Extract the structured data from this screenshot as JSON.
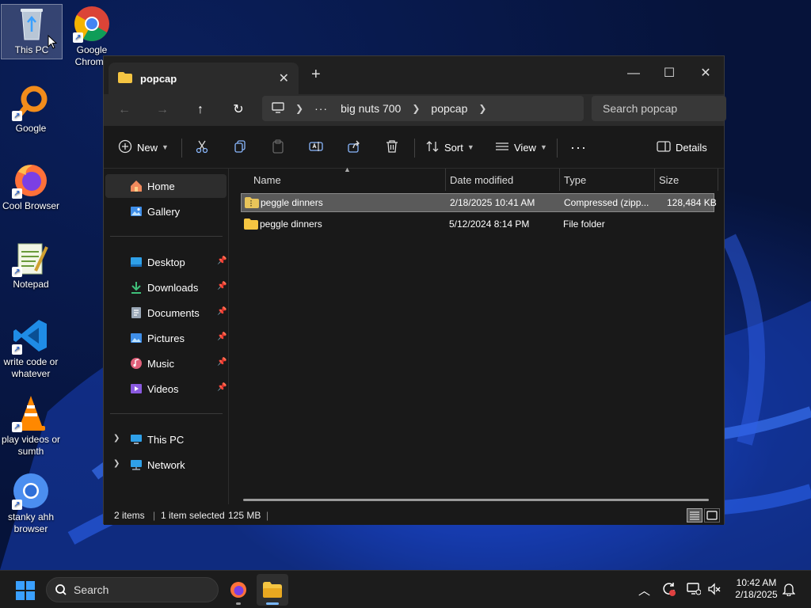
{
  "desktop": {
    "icons": [
      {
        "label": "This PC"
      },
      {
        "label": "Google Chrome"
      },
      {
        "label": "Google"
      },
      {
        "label": "Cool Browser"
      },
      {
        "label": "Notepad"
      },
      {
        "label": "write code or whatever"
      },
      {
        "label": "play videos or sumth"
      },
      {
        "label": "stanky ahh browser"
      }
    ]
  },
  "window": {
    "tab_title": "popcap",
    "controls": {
      "minimize": "—",
      "maximize": "☐",
      "close": "✕"
    },
    "breadcrumb": [
      "big nuts 700",
      "popcap"
    ],
    "search_placeholder": "Search popcap",
    "toolbar": {
      "new_label": "New",
      "sort_label": "Sort",
      "view_label": "View",
      "details_label": "Details"
    },
    "sidebar": {
      "home": "Home",
      "gallery": "Gallery",
      "pinned": [
        "Desktop",
        "Downloads",
        "Documents",
        "Pictures",
        "Music",
        "Videos"
      ],
      "this_pc": "This PC",
      "network": "Network"
    },
    "columns": {
      "name": "Name",
      "date": "Date modified",
      "type": "Type",
      "size": "Size"
    },
    "files": [
      {
        "name": "peggle dinners",
        "date": "2/18/2025 10:41 AM",
        "type": "Compressed (zipp...",
        "size": "128,484 KB",
        "kind": "zip"
      },
      {
        "name": "peggle dinners",
        "date": "5/12/2024 8:14 PM",
        "type": "File folder",
        "size": "",
        "kind": "folder"
      }
    ],
    "status": {
      "count": "2 items",
      "selected": "1 item selected",
      "size": "125 MB"
    }
  },
  "taskbar": {
    "search_label": "Search",
    "time": "10:42 AM",
    "date": "2/18/2025"
  },
  "colors": {
    "folder": "#f5c542",
    "accent": "#3aa0ff",
    "selection": "#5a5a5a"
  }
}
